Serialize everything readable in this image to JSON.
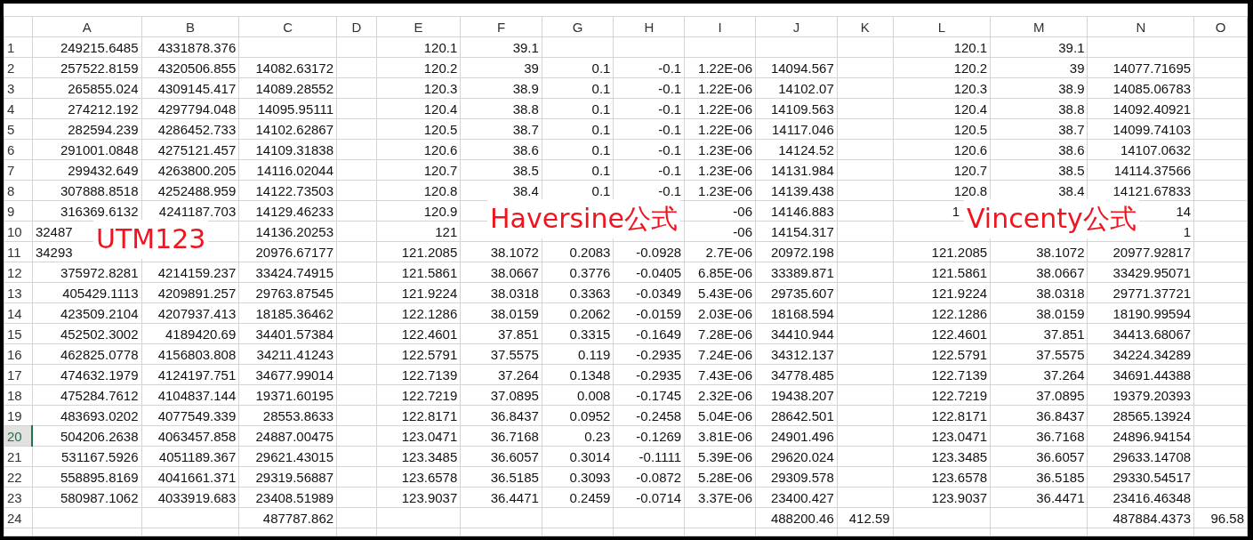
{
  "columns": [
    "A",
    "B",
    "C",
    "D",
    "E",
    "F",
    "G",
    "H",
    "I",
    "J",
    "K",
    "L",
    "M",
    "N",
    "O"
  ],
  "rows": [
    {
      "number": "1",
      "selected": false,
      "cells": {
        "A": "249215.6485",
        "B": "4331878.376",
        "E": "120.1",
        "F": "39.1",
        "L": "120.1",
        "M": "39.1"
      }
    },
    {
      "number": "2",
      "selected": false,
      "cells": {
        "A": "257522.8159",
        "B": "4320506.855",
        "C": "14082.63172",
        "E": "120.2",
        "F": "39",
        "G": "0.1",
        "H": "-0.1",
        "I": "1.22E-06",
        "J": "14094.567",
        "L": "120.2",
        "M": "39",
        "N": "14077.71695"
      }
    },
    {
      "number": "3",
      "selected": false,
      "cells": {
        "A": "265855.024",
        "B": "4309145.417",
        "C": "14089.28552",
        "E": "120.3",
        "F": "38.9",
        "G": "0.1",
        "H": "-0.1",
        "I": "1.22E-06",
        "J": "14102.07",
        "L": "120.3",
        "M": "38.9",
        "N": "14085.06783"
      }
    },
    {
      "number": "4",
      "selected": false,
      "cells": {
        "A": "274212.192",
        "B": "4297794.048",
        "C": "14095.95111",
        "E": "120.4",
        "F": "38.8",
        "G": "0.1",
        "H": "-0.1",
        "I": "1.22E-06",
        "J": "14109.563",
        "L": "120.4",
        "M": "38.8",
        "N": "14092.40921"
      }
    },
    {
      "number": "5",
      "selected": false,
      "cells": {
        "A": "282594.239",
        "B": "4286452.733",
        "C": "14102.62867",
        "E": "120.5",
        "F": "38.7",
        "G": "0.1",
        "H": "-0.1",
        "I": "1.22E-06",
        "J": "14117.046",
        "L": "120.5",
        "M": "38.7",
        "N": "14099.74103"
      }
    },
    {
      "number": "6",
      "selected": false,
      "cells": {
        "A": "291001.0848",
        "B": "4275121.457",
        "C": "14109.31838",
        "E": "120.6",
        "F": "38.6",
        "G": "0.1",
        "H": "-0.1",
        "I": "1.23E-06",
        "J": "14124.52",
        "L": "120.6",
        "M": "38.6",
        "N": "14107.0632"
      }
    },
    {
      "number": "7",
      "selected": false,
      "cells": {
        "A": "299432.649",
        "B": "4263800.205",
        "C": "14116.02044",
        "E": "120.7",
        "F": "38.5",
        "G": "0.1",
        "H": "-0.1",
        "I": "1.23E-06",
        "J": "14131.984",
        "L": "120.7",
        "M": "38.5",
        "N": "14114.37566"
      }
    },
    {
      "number": "8",
      "selected": false,
      "cells": {
        "A": "307888.8518",
        "B": "4252488.959",
        "C": "14122.73503",
        "E": "120.8",
        "F": "38.4",
        "G": "0.1",
        "H": "-0.1",
        "I": "1.23E-06",
        "J": "14139.438",
        "L": "120.8",
        "M": "38.4",
        "N": "14121.67833"
      }
    },
    {
      "number": "9",
      "selected": false,
      "cells": {
        "A": "316369.6132",
        "B": "4241187.703",
        "C": "14129.46233",
        "E": "120.9",
        "I": "-06",
        "J": "14146.883",
        "L": {
          "text": "1",
          "cut": true
        },
        "N": "14"
      }
    },
    {
      "number": "10",
      "selected": false,
      "cells": {
        "A": {
          "text": "32487",
          "cut": true
        },
        "C": "14136.20253",
        "E": "121",
        "I": "-06",
        "J": "14154.317",
        "N": "1"
      }
    },
    {
      "number": "11",
      "selected": false,
      "cells": {
        "A": {
          "text": "34293",
          "cut": true
        },
        "C": "20976.67177",
        "E": "121.2085",
        "F": "38.1072",
        "G": "0.2083",
        "H": "-0.0928",
        "I": "2.7E-06",
        "J": "20972.198",
        "L": "121.2085",
        "M": "38.1072",
        "N": "20977.92817"
      }
    },
    {
      "number": "12",
      "selected": false,
      "cells": {
        "A": "375972.8281",
        "B": "4214159.237",
        "C": "33424.74915",
        "E": "121.5861",
        "F": "38.0667",
        "G": "0.3776",
        "H": "-0.0405",
        "I": "6.85E-06",
        "J": "33389.871",
        "L": "121.5861",
        "M": "38.0667",
        "N": "33429.95071"
      }
    },
    {
      "number": "13",
      "selected": false,
      "cells": {
        "A": "405429.1113",
        "B": "4209891.257",
        "C": "29763.87545",
        "E": "121.9224",
        "F": "38.0318",
        "G": "0.3363",
        "H": "-0.0349",
        "I": "5.43E-06",
        "J": "29735.607",
        "L": "121.9224",
        "M": "38.0318",
        "N": "29771.37721"
      }
    },
    {
      "number": "14",
      "selected": false,
      "cells": {
        "A": "423509.2104",
        "B": "4207937.413",
        "C": "18185.36462",
        "E": "122.1286",
        "F": "38.0159",
        "G": "0.2062",
        "H": "-0.0159",
        "I": "2.03E-06",
        "J": "18168.594",
        "L": "122.1286",
        "M": "38.0159",
        "N": "18190.99594"
      }
    },
    {
      "number": "15",
      "selected": false,
      "cells": {
        "A": "452502.3002",
        "B": "4189420.69",
        "C": "34401.57384",
        "E": "122.4601",
        "F": "37.851",
        "G": "0.3315",
        "H": "-0.1649",
        "I": "7.28E-06",
        "J": "34410.944",
        "L": "122.4601",
        "M": "37.851",
        "N": "34413.68067"
      }
    },
    {
      "number": "16",
      "selected": false,
      "cells": {
        "A": "462825.0778",
        "B": "4156803.808",
        "C": "34211.41243",
        "E": "122.5791",
        "F": "37.5575",
        "G": "0.119",
        "H": "-0.2935",
        "I": "7.24E-06",
        "J": "34312.137",
        "L": "122.5791",
        "M": "37.5575",
        "N": "34224.34289"
      }
    },
    {
      "number": "17",
      "selected": false,
      "cells": {
        "A": "474632.1979",
        "B": "4124197.751",
        "C": "34677.99014",
        "E": "122.7139",
        "F": "37.264",
        "G": "0.1348",
        "H": "-0.2935",
        "I": "7.43E-06",
        "J": "34778.485",
        "L": "122.7139",
        "M": "37.264",
        "N": "34691.44388"
      }
    },
    {
      "number": "18",
      "selected": false,
      "cells": {
        "A": "475284.7612",
        "B": "4104837.144",
        "C": "19371.60195",
        "E": "122.7219",
        "F": "37.0895",
        "G": "0.008",
        "H": "-0.1745",
        "I": "2.32E-06",
        "J": "19438.207",
        "L": "122.7219",
        "M": "37.0895",
        "N": "19379.20393"
      }
    },
    {
      "number": "19",
      "selected": false,
      "cells": {
        "A": "483693.0202",
        "B": "4077549.339",
        "C": "28553.8633",
        "E": "122.8171",
        "F": "36.8437",
        "G": "0.0952",
        "H": "-0.2458",
        "I": "5.04E-06",
        "J": "28642.501",
        "L": "122.8171",
        "M": "36.8437",
        "N": "28565.13924"
      }
    },
    {
      "number": "20",
      "selected": true,
      "cells": {
        "A": "504206.2638",
        "B": "4063457.858",
        "C": "24887.00475",
        "E": "123.0471",
        "F": "36.7168",
        "G": "0.23",
        "H": "-0.1269",
        "I": "3.81E-06",
        "J": "24901.496",
        "L": "123.0471",
        "M": "36.7168",
        "N": "24896.94154"
      }
    },
    {
      "number": "21",
      "selected": false,
      "cells": {
        "A": "531167.5926",
        "B": "4051189.367",
        "C": "29621.43015",
        "E": "123.3485",
        "F": "36.6057",
        "G": "0.3014",
        "H": "-0.1111",
        "I": "5.39E-06",
        "J": "29620.024",
        "L": "123.3485",
        "M": "36.6057",
        "N": "29633.14708"
      }
    },
    {
      "number": "22",
      "selected": false,
      "cells": {
        "A": "558895.8169",
        "B": "4041661.371",
        "C": "29319.56887",
        "E": "123.6578",
        "F": "36.5185",
        "G": "0.3093",
        "H": "-0.0872",
        "I": "5.28E-06",
        "J": "29309.578",
        "L": "123.6578",
        "M": "36.5185",
        "N": "29330.54517"
      }
    },
    {
      "number": "23",
      "selected": false,
      "cells": {
        "A": "580987.1062",
        "B": "4033919.683",
        "C": "23408.51989",
        "E": "123.9037",
        "F": "36.4471",
        "G": "0.2459",
        "H": "-0.0714",
        "I": "3.37E-06",
        "J": "23400.427",
        "L": "123.9037",
        "M": "36.4471",
        "N": "23416.46348"
      }
    },
    {
      "number": "24",
      "selected": false,
      "cells": {
        "C": "487787.862",
        "J": "488200.46",
        "K": "412.59",
        "N": "487884.4373",
        "O": "96.58"
      }
    }
  ],
  "overlays": [
    {
      "text": "UTM123"
    },
    {
      "text": "Haversine公式"
    },
    {
      "text": "Vincenty公式"
    }
  ]
}
